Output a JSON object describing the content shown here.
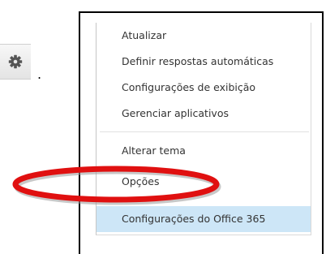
{
  "toolbar": {
    "settings_icon": "gear-icon",
    "trailing_text": "."
  },
  "menu": {
    "items": [
      {
        "label": "Atualizar"
      },
      {
        "label": "Definir respostas automáticas"
      },
      {
        "label": "Configurações de exibição"
      },
      {
        "label": "Gerenciar aplicativos"
      },
      {
        "label": "Alterar tema"
      },
      {
        "label": "Opções"
      },
      {
        "label": "Configurações do Office 365"
      }
    ],
    "highlighted_item": "Configurações do Office 365"
  },
  "annotation": {
    "type": "red-ellipse",
    "target": "Opções",
    "color": "#e01010"
  },
  "colors": {
    "highlight": "#cde6f7",
    "text": "#333333"
  }
}
